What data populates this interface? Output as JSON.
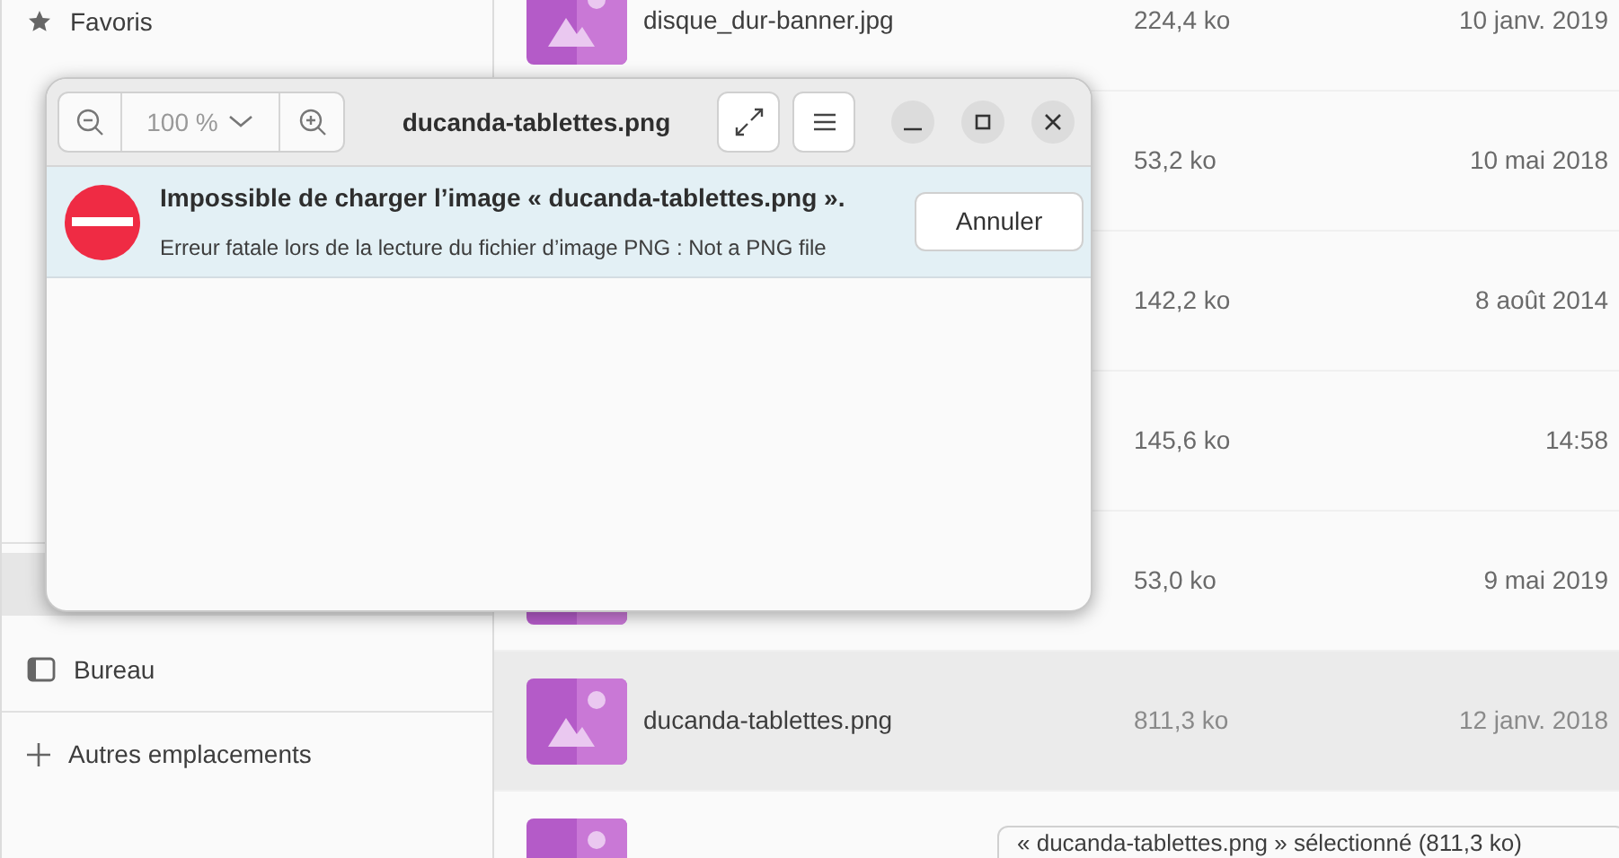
{
  "sidebar": {
    "items": [
      {
        "kind": "favorites",
        "label": "Favoris",
        "selected": false
      },
      {
        "kind": "hidden",
        "selected": true
      },
      {
        "kind": "desktop",
        "label": "Bureau",
        "selected": false
      },
      {
        "kind": "other",
        "label": "Autres emplacements",
        "selected": false
      }
    ]
  },
  "files": {
    "rows": [
      {
        "name": "disque_dur-banner.jpg",
        "size": "224,4 ko",
        "date": "10 janv. 2019",
        "selected": false
      },
      {
        "size": "53,2 ko",
        "date": "10 mai 2018",
        "selected": false
      },
      {
        "size": "142,2 ko",
        "date": "8 août 2014",
        "selected": false
      },
      {
        "size": "145,6 ko",
        "date": "14:58",
        "selected": false
      },
      {
        "size": "53,0 ko",
        "date": "9 mai 2019",
        "selected": false
      },
      {
        "name": "ducanda-tablettes.png",
        "size": "811,3 ko",
        "date": "12 janv. 2018",
        "selected": true
      },
      {
        "selected": false
      }
    ]
  },
  "status_overlay": "« ducanda-tablettes.png » sélectionné (811,3 ko)",
  "viewer": {
    "zoom": "100 %",
    "title": "ducanda-tablettes.png",
    "error": {
      "title": "Impossible de charger l’image « ducanda-tablettes.png ».",
      "message": "Erreur fatale lors de la lecture du fichier d’image PNG : Not a PNG file",
      "button": "Annuler"
    }
  }
}
